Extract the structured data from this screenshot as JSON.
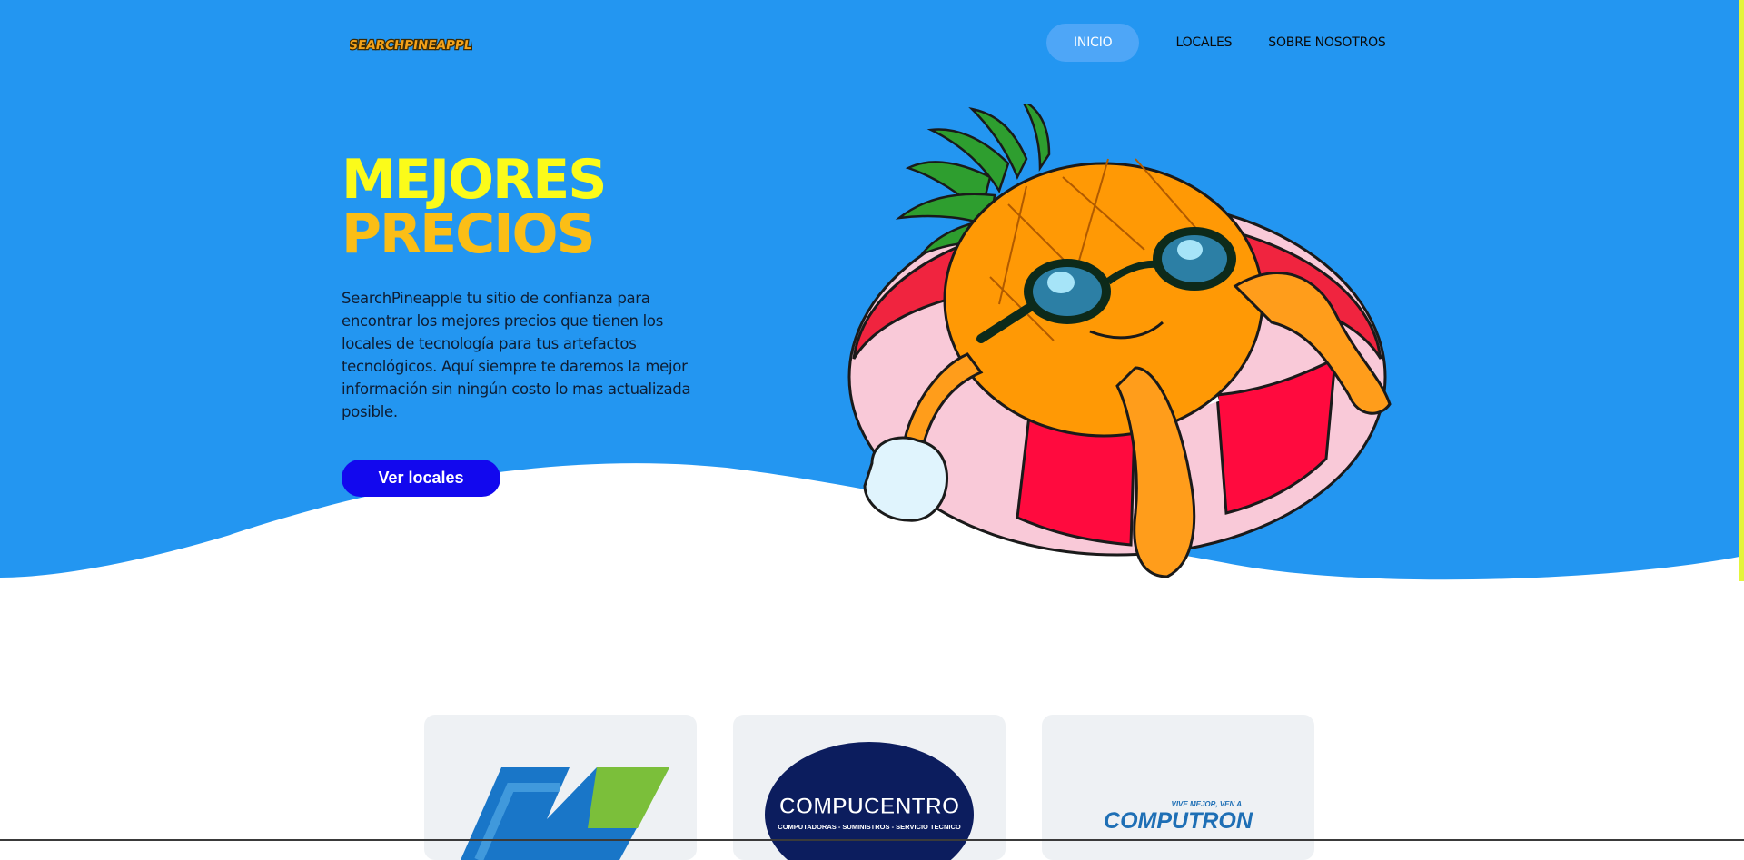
{
  "header": {
    "logo_text": "SEARCHPINEAPPLE",
    "nav": [
      {
        "label": "INICIO",
        "active": true
      },
      {
        "label": "LOCALES",
        "active": false
      },
      {
        "label": "SOBRE NOSOTROS",
        "active": false
      }
    ]
  },
  "hero": {
    "headline_line1": "MEJORES",
    "headline_line2": "PRECIOS",
    "description": "SearchPineapple tu sitio de confianza para encontrar los mejores precios que tienen los locales de tecnología para tus artefactos tecnológicos. Aquí siempre te daremos la mejor información sin ningún costo lo mas actualizada posible.",
    "cta_label": "Ver locales",
    "mascot": "pineapple-with-sunglasses-on-float-ring"
  },
  "stores": [
    {
      "name": "store-logo-n"
    },
    {
      "name": "Compucentro",
      "logo_text": "COMPUCENTRO",
      "tagline": "COMPUTADORAS - SUMINISTROS - SERVICIO TECNICO"
    },
    {
      "name": "Computron",
      "logo_text": "COMPUTRON",
      "tagline": "VIVE MEJOR, VEN A"
    }
  ],
  "colors": {
    "hero_blue": "#2396f1",
    "headline_yellow": "#fbfb1a",
    "headline_orange": "#fbbe16",
    "cta_blue": "#1208ee",
    "nav_active": "#4ea6f7"
  }
}
